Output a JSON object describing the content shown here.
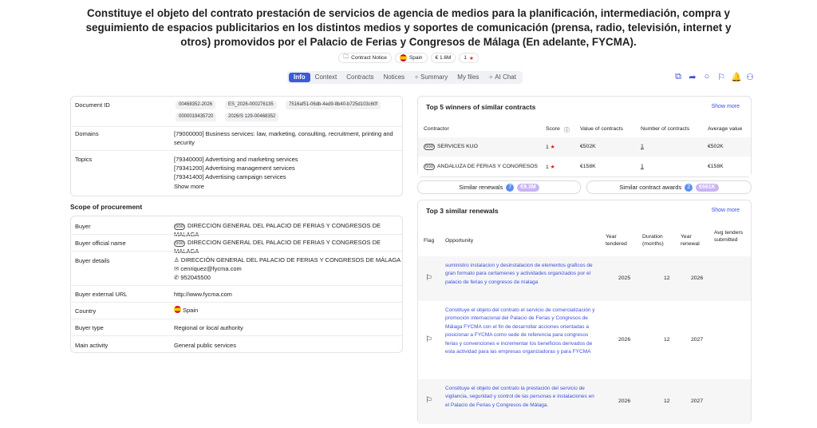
{
  "title": "Constituye el objeto del contrato prestación de servicios de agencia de medios para la planificación, intermediación, compra y seguimiento de espacios publicitarios en los distintos medios y soportes de comunicación (prensa, radio, televisión, internet y otros) promovidos por el Palacio de Ferias y Congresos de Málaga (En adelante, FYCMA).",
  "chips": {
    "notice": "Contract Notice",
    "country": "Spain",
    "value": "€ 1.6M",
    "score": "1"
  },
  "tabs": [
    "Info",
    "Context",
    "Contracts",
    "Notices",
    "Summary",
    "My files",
    "AI Chat"
  ],
  "info": {
    "doc_label": "Document ID",
    "doc_ids": [
      "00468352-2026",
      "ES_2026-000276135",
      "7516af51-06db-4ed9-8b40-b725d103c60f",
      "0000019435720",
      "2026/S 129-00468352"
    ],
    "domains_label": "Domains",
    "domains": "[79000000] Business services: law, marketing, consulting, recruitment, printing and security",
    "topics_label": "Topics",
    "topics": [
      "[79340000] Advertising and marketing services",
      "[79341200] Advertising management services",
      "[79341400] Advertising campaign services"
    ],
    "show_more": "Show more"
  },
  "scope": {
    "title": "Scope of procurement",
    "buyer_label": "Buyer",
    "buyer": "DIRECCION GENERAL DEL PALACIO DE FERIAS Y CONGRESOS DE MALAGA",
    "official_label": "Buyer official name",
    "official": "DIRECCION GENERAL DEL PALACIO DE FERIAS Y CONGRESOS DE MALAGA",
    "details_label": "Buyer details",
    "details_name": "DIRECCIÓN GENERAL DEL PALACIO DE FERIAS Y CONGRESOS DE MÁLAGA",
    "details_email": "cenriquez@fycma.com",
    "details_phone": "952045500",
    "url_label": "Buyer external URL",
    "url": "http://www.fycma.com",
    "country_label": "Country",
    "country": "Spain",
    "type_label": "Buyer type",
    "type": "Regional or local authority",
    "activity_label": "Main activity",
    "activity": "General public services"
  },
  "winners": {
    "title": "Top 5 winners of similar contracts",
    "show_more": "Show more",
    "headers": [
      "Contractor",
      "Score",
      "Value of contracts",
      "Number of contracts",
      "Average value"
    ],
    "rows": [
      {
        "name": "SERVICES KUO",
        "score": "1",
        "value": "€502K",
        "count": "1",
        "avg": "€502K"
      },
      {
        "name": "ANDALUZA DE FERIAS Y CONGRESOS",
        "score": "1",
        "value": "€158K",
        "count": "1",
        "avg": "€158K"
      }
    ]
  },
  "pills": {
    "renewals_label": "Similar renewals",
    "renewals_count": "7",
    "renewals_amount": "€9.3M",
    "awards_label": "Similar contract awards",
    "awards_count": "2",
    "awards_amount": "€661K"
  },
  "renewals": {
    "title": "Top 3 similar renewals",
    "show_more": "Show more",
    "headers": {
      "flag": "Flag",
      "opportunity": "Opportunity",
      "year_tendered": "Year tendered",
      "duration": "Duration (months)",
      "year_renewal": "Year renewal",
      "avg_tenders": "Avg tenders submitted"
    },
    "rows": [
      {
        "text": "suministro instalacion y desinstalacion de elementos graficos de gran formato para certamenes y actividades organizados por el palacio de ferias y congresos de malaga",
        "year": "2025",
        "duration": "12",
        "renewal": "2026"
      },
      {
        "text": "Constituye el objeto del contrato el servicio de comercialización y promoción internacional del Palacio de Ferias y Congresos de Málaga FYCMA con el fin de desarrollar acciones orientadas a posicionar a FYCMA como sede de referencia para congresos ferias y convenciones e incrementar los beneficios derivados de esta actividad para las empresas organizadoras y para FYCMA",
        "year": "2026",
        "duration": "12",
        "renewal": "2027"
      },
      {
        "text": "Constituye el objeto del contrato la prestación del servicio de vigilancia, seguridad y control de las personas e instalaciones en el Palacio de Ferias y Congresos de Málaga.",
        "year": "2026",
        "duration": "12",
        "renewal": "2027"
      }
    ]
  }
}
